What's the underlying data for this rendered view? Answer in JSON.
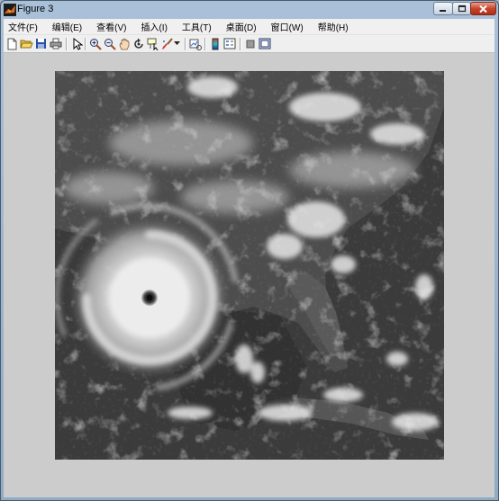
{
  "window": {
    "title": "Figure 3",
    "icon": "matlab-figure-icon",
    "controls": [
      "minimize-icon",
      "maximize-icon",
      "close-icon"
    ]
  },
  "menubar": {
    "items": [
      {
        "label": "文件(F)"
      },
      {
        "label": "编辑(E)"
      },
      {
        "label": "查看(V)"
      },
      {
        "label": "插入(I)"
      },
      {
        "label": "工具(T)"
      },
      {
        "label": "桌面(D)"
      },
      {
        "label": "窗口(W)"
      },
      {
        "label": "帮助(H)"
      }
    ]
  },
  "toolbar": {
    "buttons": [
      "new-figure-icon",
      "open-file-icon",
      "save-figure-icon",
      "print-figure-icon",
      "edit-plot-icon",
      "zoom-in-icon",
      "zoom-out-icon",
      "pan-icon",
      "rotate-3d-icon",
      "data-cursor-icon",
      "brush-icon",
      "brush-dropdown-icon",
      "link-plot-icon",
      "insert-colorbar-icon",
      "insert-legend-icon",
      "hide-plot-tools-icon",
      "show-plot-tools-icon"
    ]
  },
  "figure": {
    "content": "grayscale satellite image",
    "colors": {
      "figure_background": "#cccccc",
      "ocean": "#2e2e2e",
      "land": "#4a4a4a",
      "clouds": "#e6e6e6"
    }
  }
}
